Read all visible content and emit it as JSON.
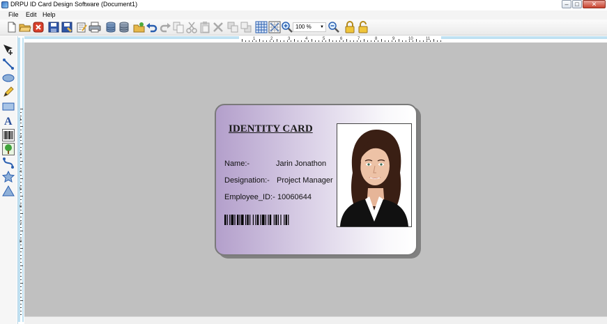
{
  "window": {
    "title": "DRPU ID Card Design Software  (Document1)",
    "controls": {
      "minimize": "–",
      "maximize": "□",
      "close": "✕"
    }
  },
  "menu": {
    "items": [
      "File",
      "Edit",
      "Help"
    ]
  },
  "toolbar": {
    "icons": [
      "new-document-icon",
      "open-folder-icon",
      "close-icon",
      "save-icon",
      "save-as-icon",
      "edit-properties-icon",
      "print-icon",
      "database-export-icon",
      "database-icon",
      "open-image-icon",
      "undo-icon",
      "redo-icon",
      "copy-icon",
      "cut-icon",
      "paste-icon",
      "delete-icon",
      "bring-forward-icon",
      "send-backward-icon",
      "grid-icon",
      "snap-grid-icon",
      "zoom-in-icon",
      "zoom-out-icon",
      "lock-icon",
      "unlock-icon"
    ],
    "zoom_value": "100 %"
  },
  "left_tools": [
    "select-move-icon",
    "line-icon",
    "ellipse-icon",
    "pencil-icon",
    "rectangle-icon",
    "text-icon",
    "barcode-icon",
    "picture-icon",
    "curve-icon",
    "star-icon",
    "triangle-icon"
  ],
  "ruler": {
    "h_numbers": [
      "1",
      "2",
      "3",
      "4",
      "5",
      "6",
      "7",
      "8",
      "9",
      "10",
      "11"
    ],
    "v_numbers": [
      "1",
      "2",
      "3",
      "4",
      "5",
      "6",
      "7",
      "8"
    ]
  },
  "card": {
    "title": "IDENTITY CARD",
    "fields": [
      {
        "label": "Name:-",
        "value": "Jarin Jonathon"
      },
      {
        "label": "Designation:-",
        "value": "Project Manager"
      },
      {
        "label": "Employee_ID:-",
        "value": "10060644"
      }
    ],
    "colors": {
      "gradient_start": "#b39fcb",
      "gradient_end": "#ffffff",
      "border": "#7a7a7a",
      "canvas": "#c0c0c0"
    }
  }
}
